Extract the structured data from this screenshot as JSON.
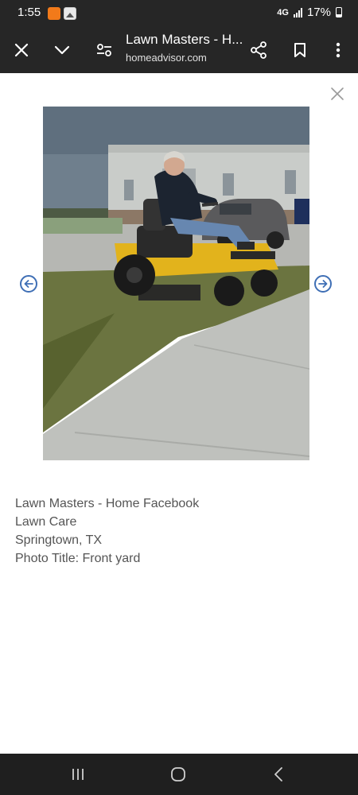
{
  "status_bar": {
    "time": "1:55",
    "network": "4G",
    "battery": "17%"
  },
  "browser": {
    "title": "Lawn Masters - H...",
    "url": "homeadvisor.com"
  },
  "listing": {
    "business": "Lawn Masters - Home Facebook",
    "category": "Lawn Care",
    "location": "Springtown, TX",
    "photo_title": "Photo Title: Front yard"
  },
  "colors": {
    "arrow_accent": "#3f6fb5",
    "mower_yellow": "#e2b31c"
  }
}
